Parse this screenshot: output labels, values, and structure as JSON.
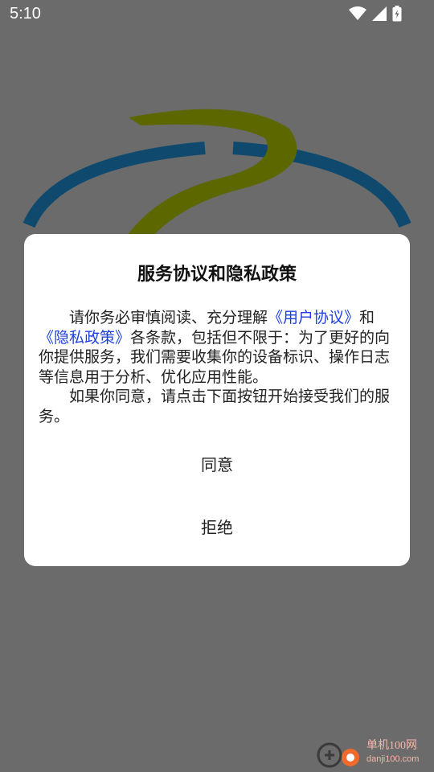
{
  "status_bar": {
    "time": "5:10",
    "icons": [
      "wifi-icon",
      "cell-signal-icon",
      "battery-icon"
    ]
  },
  "dialog": {
    "title": "服务协议和隐私政策",
    "paragraph1": {
      "lead": "请你务必审慎阅读、充分理解",
      "user_agreement_link": "《用户协议》",
      "and": "和",
      "privacy_policy_link": "《隐私政策》",
      "rest": "各条款，包括但不限于：为了更好的向你提供服务，我们需要收集你的设备标识、操作日志等信息用于分析、优化应用性能。"
    },
    "paragraph2": "如果你同意，请点击下面按钮开始接受我们的服务。",
    "agree_label": "同意",
    "reject_label": "拒绝"
  },
  "watermark": {
    "text": "单机100网",
    "url": "danji100.com"
  },
  "colors": {
    "overlay": "#6b6b6b",
    "link": "#1f3fe0",
    "logo_ring": "#0f4a6e",
    "logo_swoosh": "#5c6700"
  }
}
